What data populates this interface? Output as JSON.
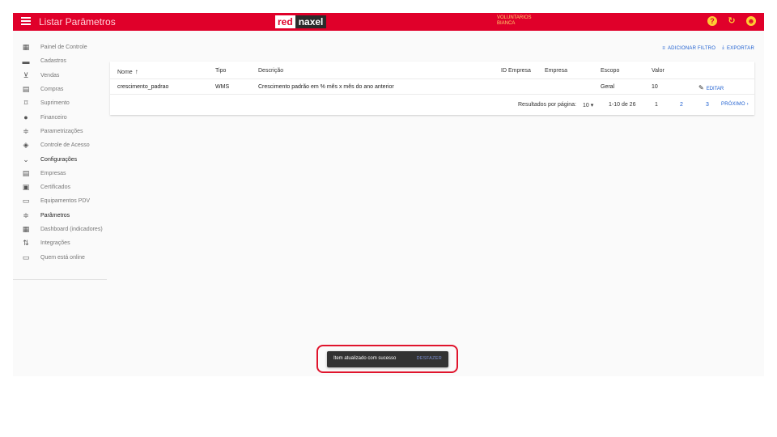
{
  "header": {
    "title": "Listar Parâmetros",
    "logo_left": "red",
    "logo_right": "naxel",
    "user_line1": "VOLUNTARIOS",
    "user_line2": "BIANCA",
    "icons": [
      "help-icon",
      "refresh-icon",
      "account-icon"
    ],
    "accent": "#e0002a"
  },
  "sidebar": {
    "items": [
      {
        "label": "Painel de Controle",
        "icon": "▦"
      },
      {
        "label": "Cadastros",
        "icon": "▬"
      },
      {
        "label": "Vendas",
        "icon": "⊻"
      },
      {
        "label": "Compras",
        "icon": "▤"
      },
      {
        "label": "Suprimento",
        "icon": "⌑"
      },
      {
        "label": "Financeiro",
        "icon": "●"
      },
      {
        "label": "Parametrizações",
        "icon": "≑"
      },
      {
        "label": "Controle de Acesso",
        "icon": "◈"
      },
      {
        "label": "Configurações",
        "icon": "⌄"
      },
      {
        "label": "Empresas",
        "icon": "▤"
      },
      {
        "label": "Certificados",
        "icon": "▣"
      },
      {
        "label": "Equipamentos PDV",
        "icon": "▭"
      },
      {
        "label": "Parâmetros",
        "icon": "≑"
      },
      {
        "label": "Dashboard (indicadores)",
        "icon": "▦"
      },
      {
        "label": "Integrações",
        "icon": "⇅"
      },
      {
        "label": "Quem está online",
        "icon": "▭"
      }
    ]
  },
  "toolbar": {
    "add_filter": "ADICIONAR FILTRO",
    "export": "EXPORTAR"
  },
  "table": {
    "columns": [
      "Nome",
      "Tipo",
      "Descrição",
      "ID Empresa",
      "Empresa",
      "Escopo",
      "Valor"
    ],
    "rows": [
      {
        "nome": "crescimento_padrao",
        "tipo": "WMS",
        "descricao": "Crescimento padrão em % mês x mês do ano anterior",
        "id_empresa": "",
        "empresa": "",
        "escopo": "Geral",
        "valor": "10",
        "edit_label": "EDITAR"
      }
    ]
  },
  "pagination": {
    "per_page_label": "Resultados por página:",
    "per_page_value": "10",
    "range": "1-10 de 26",
    "pages": [
      "1",
      "2",
      "3"
    ],
    "next_label": "PRÓXIMO"
  },
  "snackbar": {
    "message": "Item atualizado com sucesso",
    "undo_label": "DESFAZER"
  }
}
